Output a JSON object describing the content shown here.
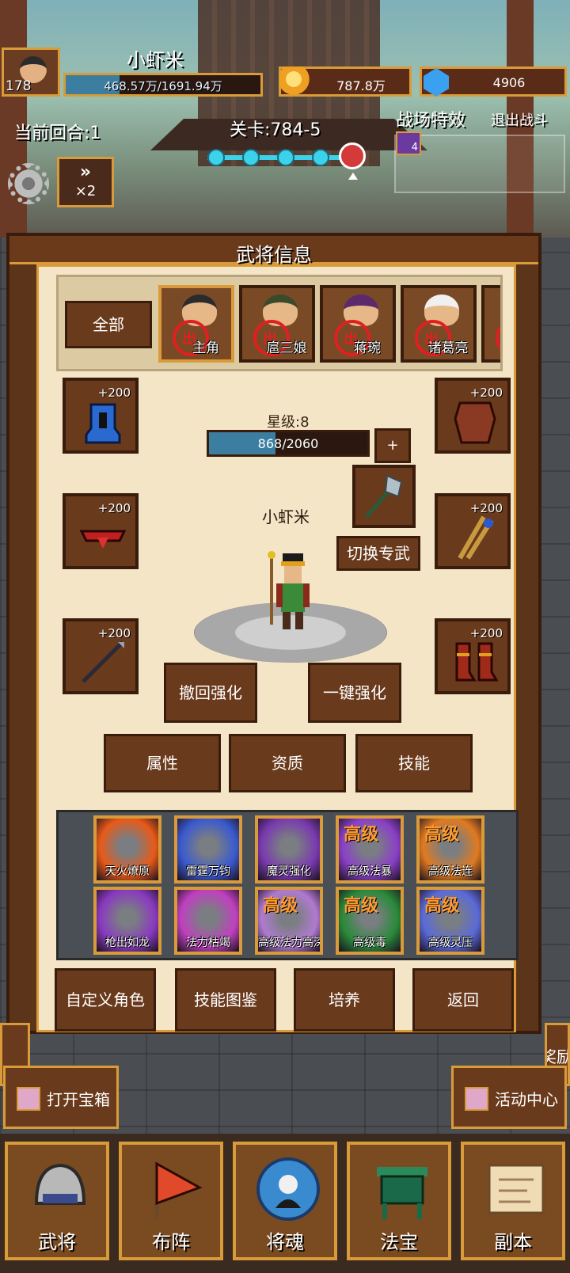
{
  "hud": {
    "level": "178",
    "player_name": "小虾米",
    "hp_text": "468.57万/1691.94万",
    "hp_fraction": 0.277,
    "gold": "787.8万",
    "gems": "4906",
    "round_label": "当前回合:1",
    "stage_label": "关卡:784-5",
    "stage_progress_dots": 4,
    "battle_effect_label": "战场特效",
    "exit_battle_label": "退出战斗",
    "effect_count": "4",
    "speed_label": "×2"
  },
  "panel": {
    "title": "武将信息",
    "tab_all": "全部",
    "heroes": [
      {
        "name": "主角",
        "badge": "出",
        "active": true
      },
      {
        "name": "扈三娘",
        "badge": "出",
        "active": false
      },
      {
        "name": "蒋琬",
        "badge": "出",
        "active": false
      },
      {
        "name": "诸葛亮",
        "badge": "出",
        "active": false
      },
      {
        "name": "",
        "badge": "出",
        "active": false
      }
    ],
    "star_level": "星级:8",
    "exp_text": "868/2060",
    "exp_fraction": 0.421,
    "plus_button": "+",
    "hero_name": "小虾米",
    "switch_weapon": "切换专武",
    "equipment": {
      "helmet": "+200",
      "armor_right": "+200",
      "belt": "+200",
      "quiver": "+200",
      "spear": "+200",
      "boots": "+200"
    },
    "revoke_enhance": "撤回强化",
    "one_click_enhance": "一键强化",
    "tab_attributes": "属性",
    "tab_aptitude": "资质",
    "tab_skills": "技能",
    "skills": [
      {
        "name": "天火燎原",
        "tag": "",
        "color": "#e85a18"
      },
      {
        "name": "雷霆万钧",
        "tag": "",
        "color": "#3a5ad0"
      },
      {
        "name": "魔灵强化",
        "tag": "",
        "color": "#7a3ab0"
      },
      {
        "name": "高级法暴",
        "tag": "高级",
        "color": "#8a40c8"
      },
      {
        "name": "高级法连",
        "tag": "高级",
        "color": "#e07a20"
      },
      {
        "name": "枪出如龙",
        "tag": "",
        "color": "#8a3ac0"
      },
      {
        "name": "法力枯竭",
        "tag": "",
        "color": "#c040c0"
      },
      {
        "name": "高级法力高深",
        "tag": "高级",
        "color": "#b07ad0"
      },
      {
        "name": "高级毒",
        "tag": "高级",
        "color": "#2a8a3a"
      },
      {
        "name": "高级灵压",
        "tag": "高级",
        "color": "#5a6ad8"
      }
    ],
    "bottom_buttons": [
      "自定义角色",
      "技能图鉴",
      "培养",
      "返回"
    ]
  },
  "side": {
    "open_chest": "打开宝箱",
    "activity_center": "活动中心",
    "partial_right": "奖励"
  },
  "nav": [
    "武将",
    "布阵",
    "将魂",
    "法宝",
    "副本"
  ]
}
